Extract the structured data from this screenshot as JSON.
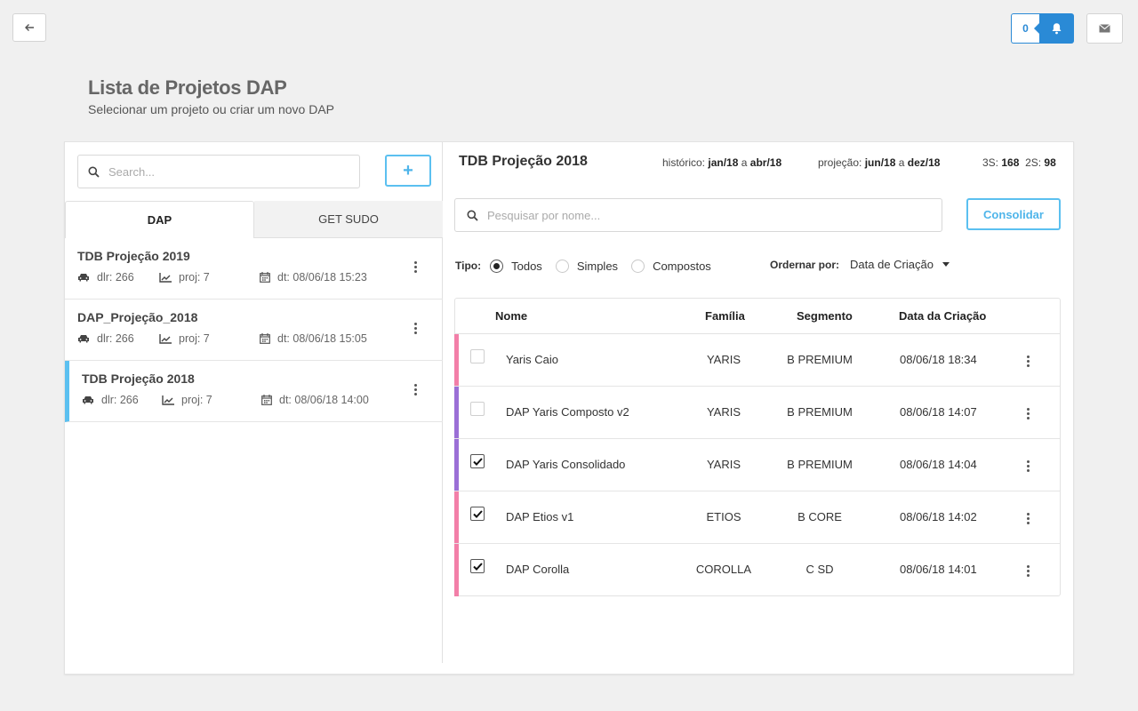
{
  "header": {
    "notification_count": "0",
    "title": "Lista de Projetos DAP",
    "subtitle": "Selecionar um projeto ou criar um novo DAP"
  },
  "left": {
    "search_placeholder": "Search...",
    "add_label": "+",
    "tabs": [
      {
        "label": "DAP",
        "active": true
      },
      {
        "label": "GET SUDO",
        "active": false
      }
    ],
    "projects": [
      {
        "name": "TDB Projeção 2019",
        "dlr": "dlr: 266",
        "proj": "proj: 7",
        "dt": "dt: 08/06/18 15:23",
        "selected": false
      },
      {
        "name": "DAP_Projeção_2018",
        "dlr": "dlr: 266",
        "proj": "proj: 7",
        "dt": "dt: 08/06/18 15:05",
        "selected": false
      },
      {
        "name": "TDB Projeção 2018",
        "dlr": "dlr: 266",
        "proj": "proj: 7",
        "dt": "dt: 08/06/18 14:00",
        "selected": true
      }
    ]
  },
  "right": {
    "title": "TDB Projeção 2018",
    "historico_label": "histórico:",
    "historico_from": "jan/18",
    "historico_sep": "a",
    "historico_to": "abr/18",
    "projecao_label": "projeção:",
    "projecao_from": "jun/18",
    "projecao_sep": "a",
    "projecao_to": "dez/18",
    "s3_label": "3S:",
    "s3_value": "168",
    "s2_label": "2S:",
    "s2_value": "98",
    "search_placeholder": "Pesquisar por nome...",
    "consolidar_label": "Consolidar",
    "tipo_label": "Tipo:",
    "tipo_options": [
      {
        "label": "Todos",
        "selected": true
      },
      {
        "label": "Simples",
        "selected": false
      },
      {
        "label": "Compostos",
        "selected": false
      }
    ],
    "order_label": "Ordernar por:",
    "order_value": "Data de Criação",
    "table": {
      "headers": [
        "Nome",
        "Família",
        "Segmento",
        "Data da Criação"
      ],
      "rows": [
        {
          "nome": "Yaris Caio",
          "familia": "YARIS",
          "segmento": "B PREMIUM",
          "data": "08/06/18 18:34",
          "checked": false,
          "color": "#f27fa8"
        },
        {
          "nome": "DAP Yaris Composto v2",
          "familia": "YARIS",
          "segmento": "B PREMIUM",
          "data": "08/06/18 14:07",
          "checked": false,
          "color": "#9b6fd6"
        },
        {
          "nome": "DAP Yaris Consolidado",
          "familia": "YARIS",
          "segmento": "B PREMIUM",
          "data": "08/06/18 14:04",
          "checked": true,
          "color": "#9b6fd6"
        },
        {
          "nome": "DAP Etios v1",
          "familia": "ETIOS",
          "segmento": "B CORE",
          "data": "08/06/18 14:02",
          "checked": true,
          "color": "#f27fa8"
        },
        {
          "nome": "DAP Corolla",
          "familia": "COROLLA",
          "segmento": "C SD",
          "data": "08/06/18 14:01",
          "checked": true,
          "color": "#f27fa8"
        }
      ]
    }
  },
  "colors": {
    "accent": "#5bc0f0",
    "notification": "#2a8ad6",
    "pink": "#f27fa8",
    "purple": "#9b6fd6"
  }
}
